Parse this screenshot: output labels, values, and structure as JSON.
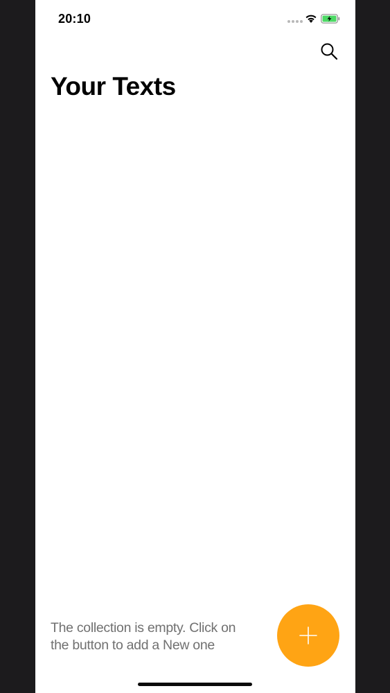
{
  "status_bar": {
    "time": "20:10",
    "battery_state": "charging",
    "wifi": "full"
  },
  "header": {
    "title": "Your Texts",
    "search_icon": "search-icon"
  },
  "empty_state": {
    "message_line1": "The collection is empty. Click on",
    "message_line2": "the button to add a New one"
  },
  "fab": {
    "icon": "plus-icon",
    "color": "#ffa414"
  },
  "colors": {
    "accent": "#ffa414",
    "battery_fill": "#4cd964",
    "background": "#ffffff"
  }
}
